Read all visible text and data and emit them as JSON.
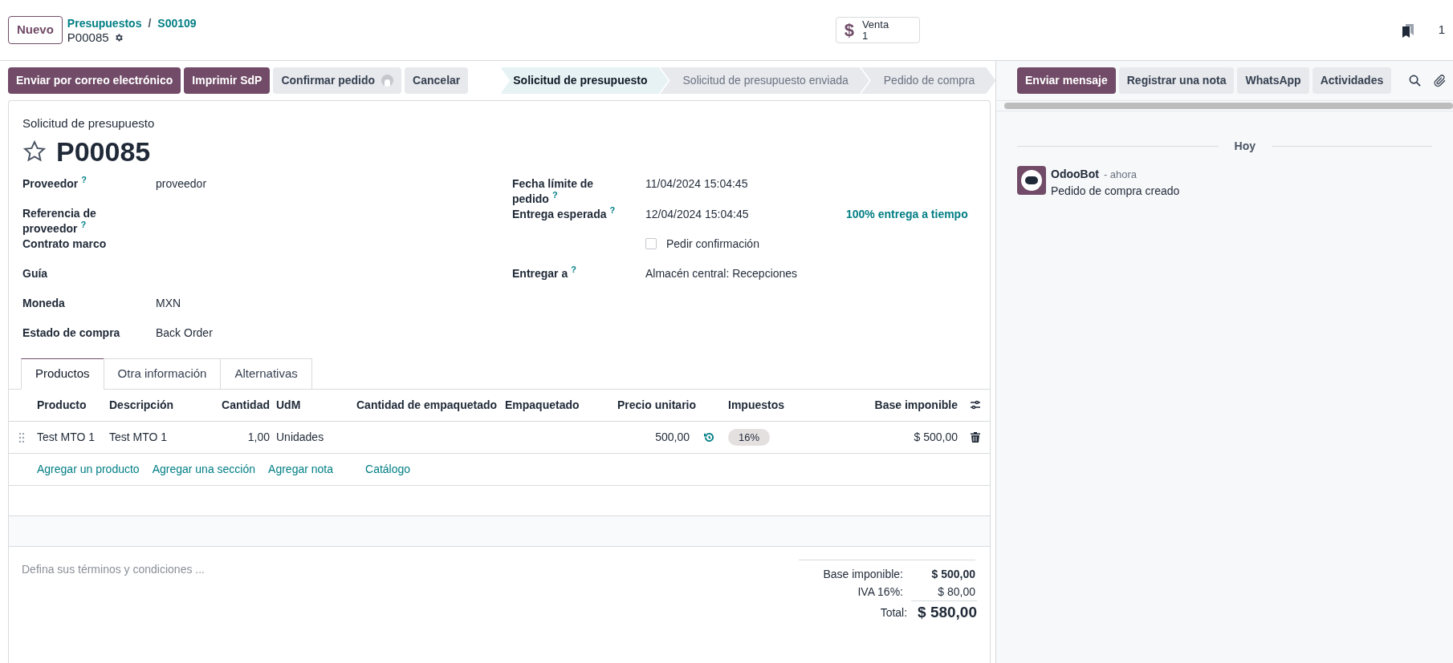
{
  "control_panel": {
    "new_button": "Nuevo",
    "breadcrumbs": [
      "Presupuestos",
      "S00109"
    ],
    "breadcrumb_separator": "/",
    "record": "P00085",
    "smart_button": {
      "icon": "$",
      "label": "Venta",
      "count": "1"
    },
    "pager_count": "1"
  },
  "action_buttons": [
    {
      "label": "Enviar por correo electrónico",
      "kind": "primary",
      "avatar": false
    },
    {
      "label": "Imprimir SdP",
      "kind": "primary",
      "avatar": false
    },
    {
      "label": "Confirmar pedido",
      "kind": "secondary",
      "avatar": true
    },
    {
      "label": "Cancelar",
      "kind": "secondary",
      "avatar": false
    }
  ],
  "statusbar": [
    {
      "label": "Solicitud de presupuesto",
      "selected": true
    },
    {
      "label": "Solicitud de presupuesto enviada",
      "selected": false
    },
    {
      "label": "Pedido de compra",
      "selected": false
    }
  ],
  "form": {
    "subtitle": "Solicitud de presupuesto",
    "title": "P00085",
    "favorite": false,
    "left_fields": [
      {
        "label": "Proveedor",
        "help": "?",
        "value": "proveedor"
      },
      {
        "label": "Referencia de proveedor",
        "help": "?"
      },
      {
        "label": "Contrato marco"
      },
      {
        "label": "Guía"
      },
      {
        "label": "Moneda",
        "value": "MXN"
      },
      {
        "label": "Estado de compra",
        "value": "Back Order"
      }
    ],
    "right_fields": [
      {
        "kind": "field",
        "label": "Fecha límite de pedido",
        "help": "?",
        "value": "11/04/2024 15:04:45"
      },
      {
        "kind": "field",
        "label": "Entrega esperada",
        "help": "?",
        "value": "12/04/2024 15:04:45",
        "extra": "100% entrega a tiempo"
      },
      {
        "kind": "checkbox",
        "label": "Pedir confirmación",
        "checked": false
      },
      {
        "kind": "field",
        "label": "Entregar a",
        "help": "?",
        "value": "Almacén central: Recepciones"
      }
    ]
  },
  "tabs": [
    {
      "label": "Productos",
      "selected": true
    },
    {
      "label": "Otra información",
      "selected": false
    },
    {
      "label": "Alternativas",
      "selected": false
    }
  ],
  "table": {
    "columns": [
      "Producto",
      "Descripción",
      "Cantidad",
      "UdM",
      "Cantidad de empaquetado",
      "Empaquetado",
      "Precio unitario",
      "Impuestos",
      "Base imponible"
    ],
    "rows": [
      {
        "product": "Test MTO 1",
        "description": "Test MTO 1",
        "quantity": "1,00",
        "uom": "Unidades",
        "unit_price": "500,00",
        "taxes": "16%",
        "subtotal": "$ 500,00"
      }
    ],
    "add_links": [
      "Agregar un producto",
      "Agregar una sección",
      "Agregar nota",
      "Catálogo"
    ]
  },
  "terms": {
    "placeholder": "Defina sus términos y condiciones ..."
  },
  "totals": [
    {
      "label": "Base imponible:",
      "value": "$ 500,00",
      "kind": "subtotal"
    },
    {
      "label": "IVA 16%:",
      "value": "$ 80,00",
      "kind": "tax"
    },
    {
      "label": "Total:",
      "value": "$ 580,00",
      "kind": "total"
    }
  ],
  "chatter": {
    "buttons": [
      {
        "label": "Enviar mensaje",
        "kind": "primary"
      },
      {
        "label": "Registrar una nota",
        "kind": "secondary"
      },
      {
        "label": "WhatsApp",
        "kind": "secondary"
      },
      {
        "label": "Actividades",
        "kind": "secondary"
      }
    ],
    "date_separator": "Hoy",
    "messages": [
      {
        "author": "OdooBot",
        "time": "- ahora",
        "body": "Pedido de compra creado"
      }
    ]
  }
}
